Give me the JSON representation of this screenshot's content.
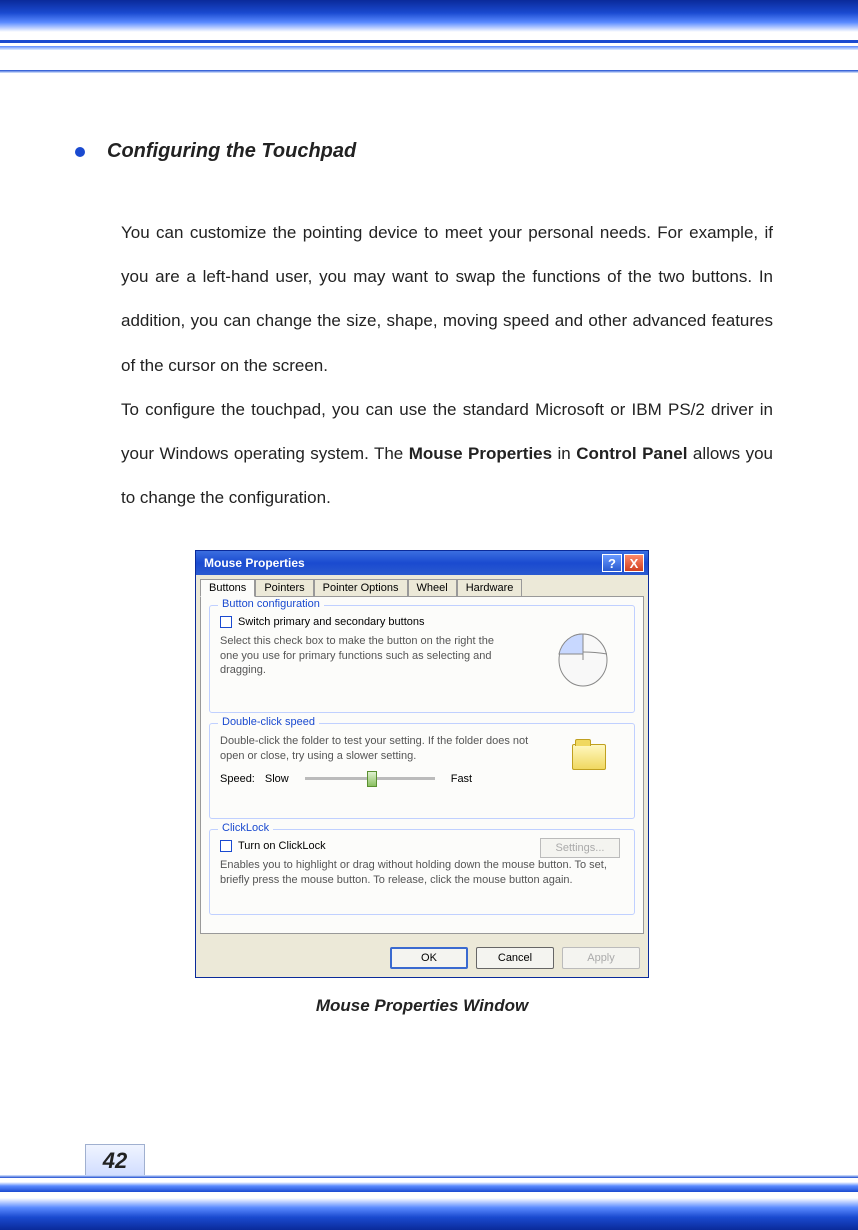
{
  "page_number": "42",
  "heading": "Configuring the Touchpad",
  "paragraph1": "You can customize the pointing device to meet your personal needs. For example, if you are a left-hand user, you may want to swap the functions of the two buttons.   In addition, you can change the size, shape, moving speed and other advanced features of the cursor on the screen.",
  "paragraph2_a": "To configure the touchpad, you can use the standard Microsoft or IBM PS/2 driver in your Windows operating system.   The ",
  "paragraph2_b": "Mouse Properties",
  "paragraph2_c": " in ",
  "paragraph2_d": "Control Panel",
  "paragraph2_e": " allows you to change the configuration.",
  "dialog": {
    "title": "Mouse Properties",
    "help": "?",
    "close": "X",
    "tabs": [
      "Buttons",
      "Pointers",
      "Pointer Options",
      "Wheel",
      "Hardware"
    ],
    "group_button_config": {
      "legend": "Button configuration",
      "checkbox_label": "Switch primary and secondary buttons",
      "text": "Select this check box to make the button on the right the one you use for primary functions such as selecting and dragging."
    },
    "group_doubleclick": {
      "legend": "Double-click speed",
      "text": "Double-click the folder to test your setting. If the folder does not open or close, try using a slower setting.",
      "speed_label": "Speed:",
      "slow": "Slow",
      "fast": "Fast"
    },
    "group_clicklock": {
      "legend": "ClickLock",
      "checkbox_label": "Turn on ClickLock",
      "settings": "Settings...",
      "text": "Enables you to highlight or drag without holding down the mouse button. To set, briefly press the mouse button. To release, click the mouse button again."
    },
    "buttons": {
      "ok": "OK",
      "cancel": "Cancel",
      "apply": "Apply"
    }
  },
  "caption": "Mouse Properties Window"
}
